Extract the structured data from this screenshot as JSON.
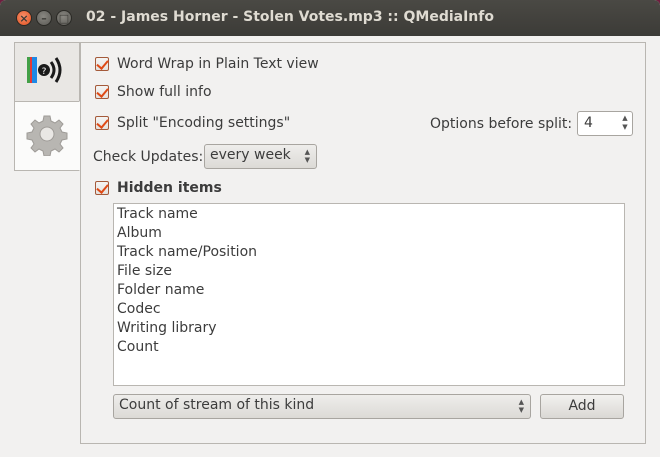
{
  "window": {
    "title": "02 - James Horner - Stolen Votes.mp3 :: QMediaInfo"
  },
  "tabs": [
    {
      "icon": "mediainfo-logo-icon"
    },
    {
      "icon": "gear-icon"
    }
  ],
  "options": {
    "word_wrap": "Word Wrap in Plain Text view",
    "show_full_info": "Show full info",
    "split_encoding": "Split \"Encoding settings\"",
    "options_before_split_label": "Options before split:",
    "options_before_split_value": "4",
    "check_updates_label": "Check Updates:",
    "check_updates_value": "every week",
    "hidden_items": "Hidden items"
  },
  "hidden_list": [
    "Track name",
    "Album",
    "Track name/Position",
    "File size",
    "Folder name",
    "Codec",
    "Writing library",
    "Count"
  ],
  "field_select": {
    "value": "Count of stream of this kind"
  },
  "add_button": "Add",
  "colors": {
    "titlebar": "#3c3b37",
    "accent": "#df4a16",
    "background": "#f2f1f0"
  }
}
